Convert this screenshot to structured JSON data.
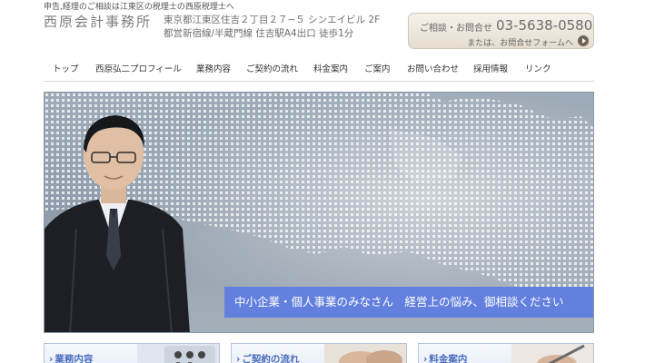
{
  "header": {
    "tagline": "申告,経理のご相談は江東区の税理士の西原税理士へ",
    "logo": "西原会計事務所",
    "address_line1": "東京都江東区住吉２丁目２７−５ シンエイビル 2F",
    "address_line2": "都営新宿線/半蔵門線 住吉駅A4出口 徒歩1分",
    "contact": {
      "label": "ご相談・お問合せ",
      "phone": "03-5638-0580",
      "form_link": "または、お問合せフォームへ"
    }
  },
  "nav": {
    "items": [
      {
        "label": "トップ"
      },
      {
        "label": "西原弘二プロフィール"
      },
      {
        "label": "業務内容"
      },
      {
        "label": "ご契約の流れ"
      },
      {
        "label": "料金案内"
      },
      {
        "label": "ご案内"
      },
      {
        "label": "お問い合わせ"
      },
      {
        "label": "採用情報"
      },
      {
        "label": "リンク"
      }
    ]
  },
  "hero": {
    "banner": "中小企業・個人事業のみなさん　経営上の悩み、御相談ください"
  },
  "cards": [
    {
      "label": "業務内容",
      "icon": "calculator"
    },
    {
      "label": "ご契約の流れ",
      "icon": "handshake"
    },
    {
      "label": "料金案内",
      "icon": "pen"
    }
  ],
  "colors": {
    "accent": "#5e7ce2",
    "card_text": "#4a6dbd",
    "contact_bg": "#ece5d8"
  }
}
